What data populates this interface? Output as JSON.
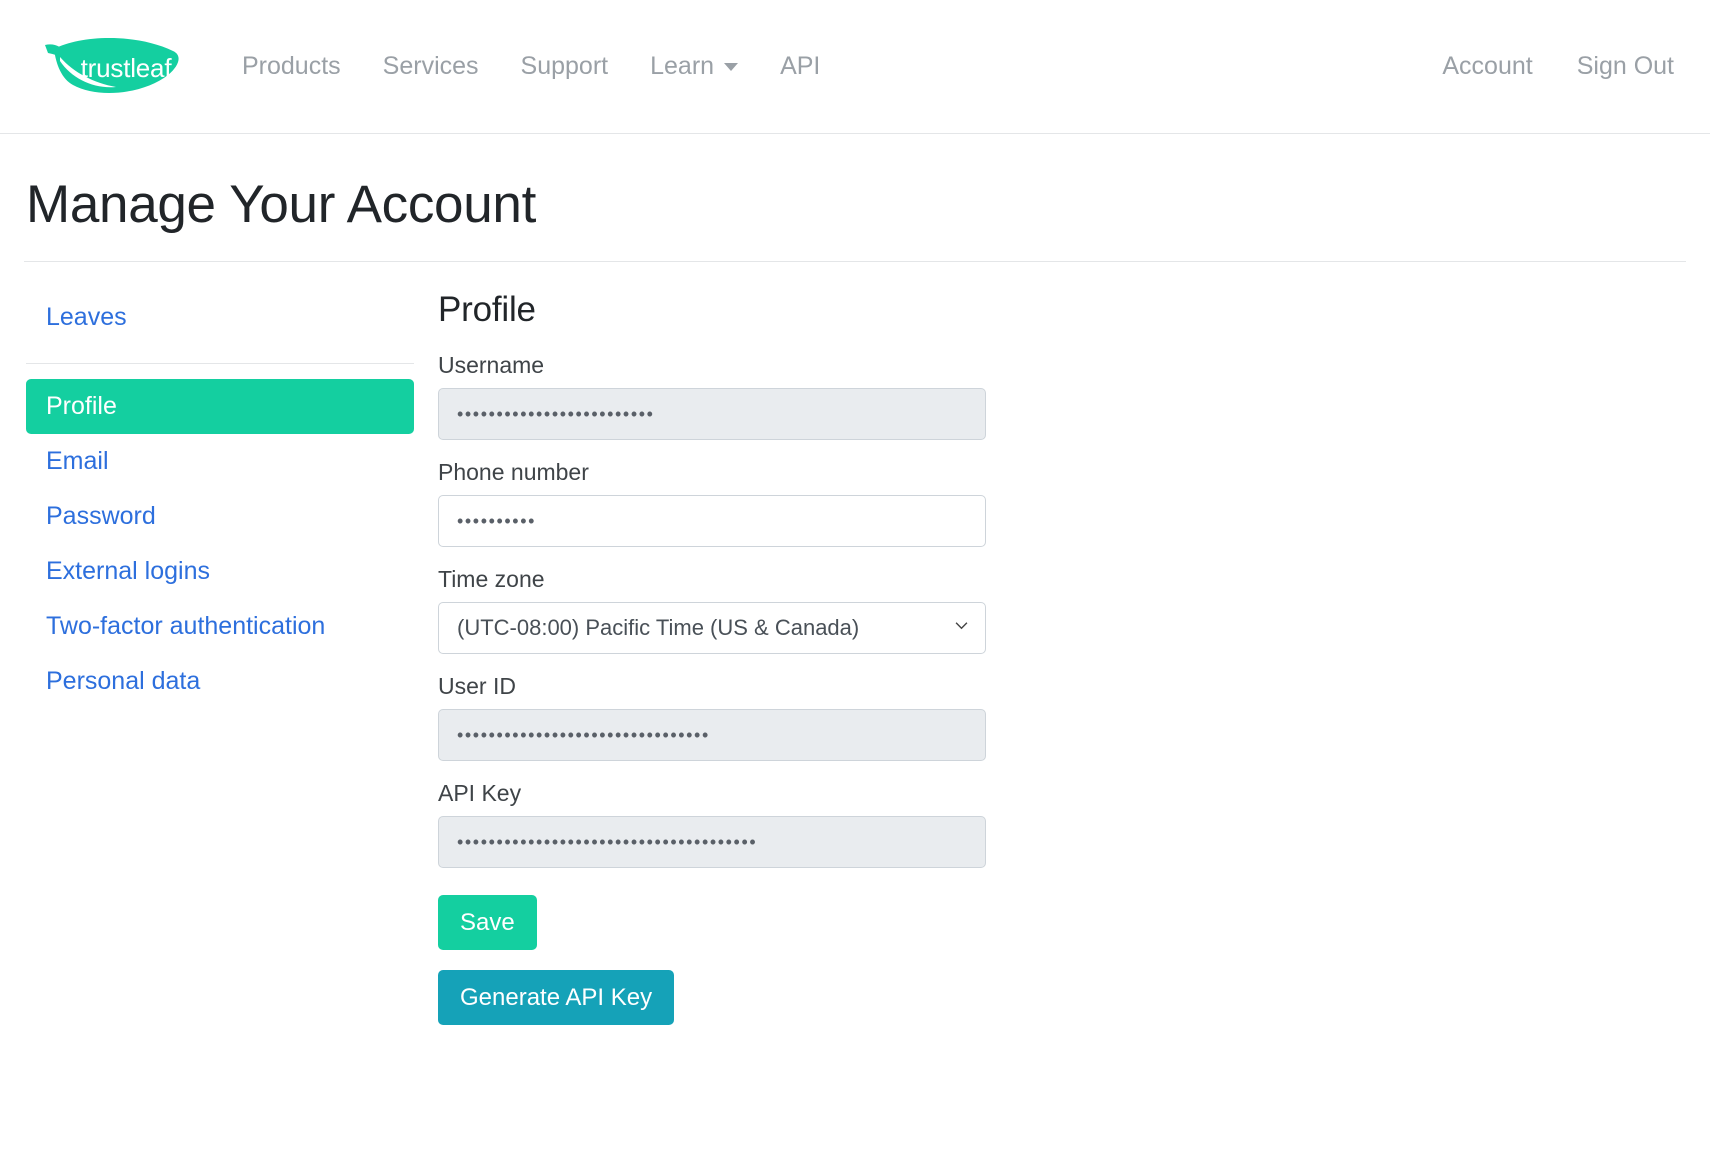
{
  "brand": {
    "name": "trustleaf",
    "logo_color": "#14cfa0"
  },
  "navbar": {
    "links": [
      {
        "label": "Products",
        "has_caret": false
      },
      {
        "label": "Services",
        "has_caret": false
      },
      {
        "label": "Support",
        "has_caret": false
      },
      {
        "label": "Learn",
        "has_caret": true
      },
      {
        "label": "API",
        "has_caret": false
      }
    ],
    "right_links": [
      {
        "label": "Account"
      },
      {
        "label": "Sign Out"
      }
    ]
  },
  "page": {
    "title": "Manage Your Account"
  },
  "sidebar": {
    "top_items": [
      {
        "label": "Leaves",
        "active": false
      }
    ],
    "items": [
      {
        "label": "Profile",
        "active": true
      },
      {
        "label": "Email",
        "active": false
      },
      {
        "label": "Password",
        "active": false
      },
      {
        "label": "External logins",
        "active": false
      },
      {
        "label": "Two-factor authentication",
        "active": false
      },
      {
        "label": "Personal data",
        "active": false
      }
    ]
  },
  "profile": {
    "heading": "Profile",
    "fields": {
      "username": {
        "label": "Username",
        "value": "•••••••••••••••••••••••••",
        "disabled": true
      },
      "phone": {
        "label": "Phone number",
        "value": "••••••••••",
        "disabled": false
      },
      "timezone": {
        "label": "Time zone",
        "value": "(UTC-08:00) Pacific Time (US & Canada)",
        "disabled": false
      },
      "user_id": {
        "label": "User ID",
        "value": "••••••••••••••••••••••••••••••••",
        "disabled": true
      },
      "api_key": {
        "label": "API Key",
        "value": "••••••••••••••••••••••••••••••••••••••",
        "disabled": true
      }
    },
    "buttons": {
      "save": {
        "label": "Save",
        "color": "#14cfa0"
      },
      "generate_api_key": {
        "label": "Generate API Key",
        "color": "#15a2b8"
      }
    }
  }
}
